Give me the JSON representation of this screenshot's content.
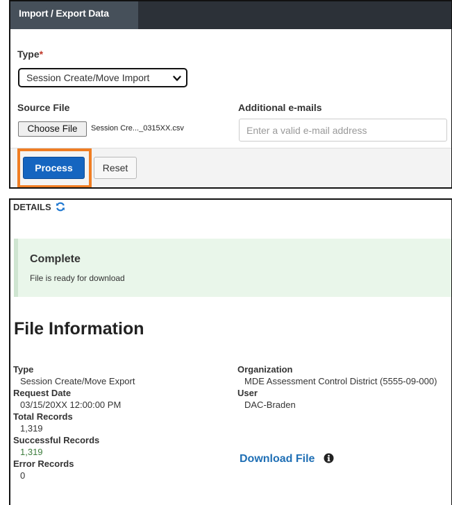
{
  "import_panel": {
    "tab_label": "Import / Export Data",
    "type_label": "Type",
    "required_marker": "*",
    "type_value": "Session Create/Move Import",
    "source_file_label": "Source File",
    "choose_file_label": "Choose File",
    "file_name": "Session Cre..._0315XX.csv",
    "emails_label": "Additional e-mails",
    "email_placeholder": "Enter a valid e-mail address",
    "process_label": "Process",
    "reset_label": "Reset",
    "highlight_color": "#f07d22",
    "primary_color": "#1565c0"
  },
  "details_panel": {
    "details_label": "DETAILS",
    "status_title": "Complete",
    "status_message": "File is ready for download",
    "section_title": "File Information",
    "left_fields": [
      {
        "label": "Type",
        "value": "Session Create/Move Export"
      },
      {
        "label": "Request Date",
        "value": "03/15/20XX 12:00:00 PM"
      },
      {
        "label": "Total Records",
        "value": "1,319"
      },
      {
        "label": "Successful Records",
        "value": "1,319"
      },
      {
        "label": "Error Records",
        "value": "0"
      }
    ],
    "right_fields": [
      {
        "label": "Organization",
        "value": "MDE Assessment Control District (5555-09-000)"
      },
      {
        "label": "User",
        "value": "DAC-Braden"
      }
    ],
    "download_label": "Download File",
    "link_color": "#1f6fb5",
    "success_color": "#3d7d3d"
  }
}
